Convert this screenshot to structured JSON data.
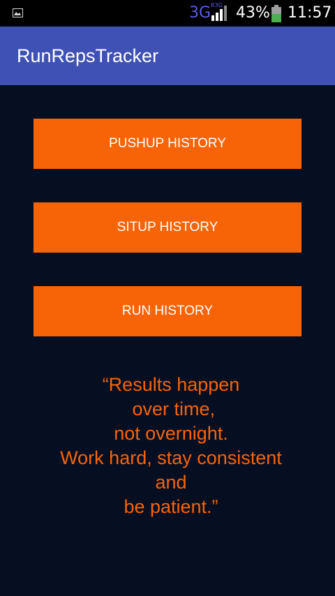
{
  "status_bar": {
    "network_type": "3G",
    "roaming_label": "R3G",
    "battery_percent": "43%",
    "time": "11:57",
    "icons": [
      "image-notification-icon",
      "signal-icon",
      "battery-icon"
    ]
  },
  "app_bar": {
    "title": "RunRepsTracker",
    "color": "#3f51b5"
  },
  "buttons": {
    "pushup_label": "PUSHUP HISTORY",
    "situp_label": "SITUP HISTORY",
    "run_label": "RUN HISTORY",
    "color": "#f76407"
  },
  "quote": {
    "lines": [
      "“Results happen",
      " over time,",
      "not overnight.",
      "Work hard, stay consistent",
      "and",
      "be patient.”"
    ],
    "color": "#f76407"
  },
  "background_color": "#060e21"
}
